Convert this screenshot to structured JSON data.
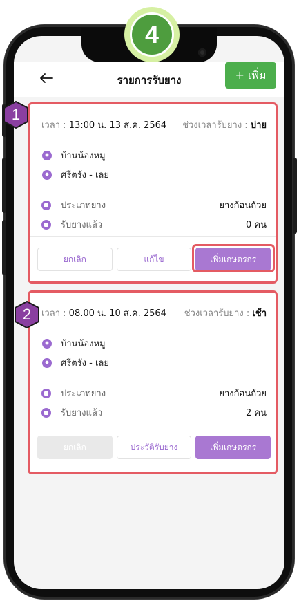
{
  "step_badge": "4",
  "header": {
    "title": "รายการรับยาง",
    "add_label": "+ เพิ่ม"
  },
  "cards": [
    {
      "badge": "1",
      "time_label": "เวลา :",
      "time_value": "13:00 น. 13 ส.ค. 2564",
      "slot_label": "ช่วงเวลารับยาง :",
      "slot_value": "บ่าย",
      "location_name": "บ้านน้องหมู",
      "location_area": "ศรีตรัง - เลย",
      "type_label": "ประเภทยาง",
      "type_value": "ยางก้อนถ้วย",
      "received_label": "รับยางแล้ว",
      "received_value": "0 คน",
      "buttons": [
        "ยกเลิก",
        "แก้ไข",
        "เพิ่มเกษตรกร"
      ]
    },
    {
      "badge": "2",
      "time_label": "เวลา :",
      "time_value": "08.00 น. 10 ส.ค. 2564",
      "slot_label": "ช่วงเวลารับยาง :",
      "slot_value": "เช้า",
      "location_name": "บ้านน้องหมู",
      "location_area": "ศรีตรัง - เลย",
      "type_label": "ประเภทยาง",
      "type_value": "ยางก้อนถ้วย",
      "received_label": "รับยางแล้ว",
      "received_value": "2 คน",
      "buttons": [
        "ยกเลิก",
        "ประวัติรับยาง",
        "เพิ่มเกษตรกร"
      ]
    }
  ],
  "colors": {
    "accent_purple": "#a978d2",
    "add_green": "#4cae4c",
    "highlight_red": "#e45b63",
    "badge_purple": "#8a3fa0"
  }
}
